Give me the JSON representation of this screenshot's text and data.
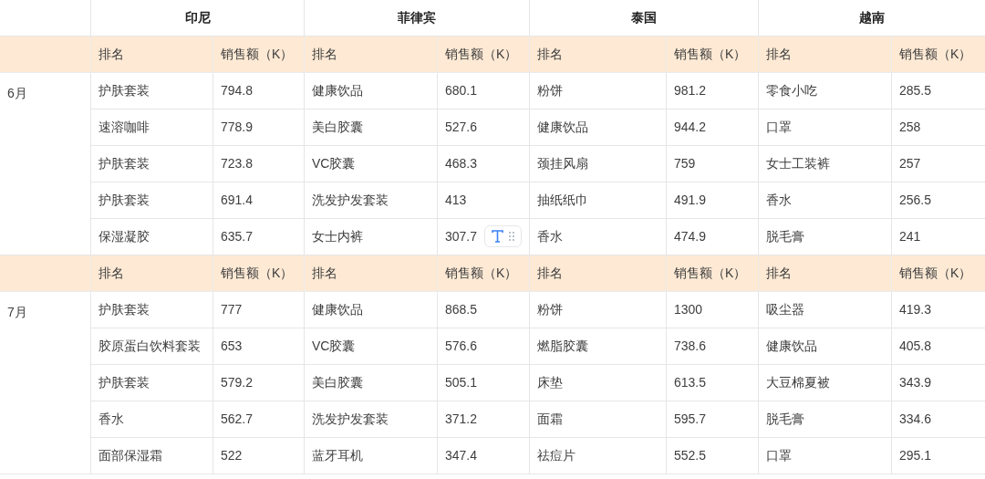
{
  "countries": [
    "印尼",
    "菲律宾",
    "泰国",
    "越南"
  ],
  "months": [
    {
      "month": "6月",
      "header": [
        "排名",
        "销售额（K）",
        "排名",
        "销售额（K）",
        "排名",
        "销售额（K）",
        "排名",
        "销售额（K）"
      ],
      "rows": [
        [
          "护肤套装",
          "794.8",
          "健康饮品",
          "680.1",
          "粉饼",
          "981.2",
          "零食小吃",
          "285.5"
        ],
        [
          "速溶咖啡",
          "778.9",
          "美白胶囊",
          "527.6",
          "健康饮品",
          "944.2",
          "口罩",
          "258"
        ],
        [
          "护肤套装",
          "723.8",
          "VC胶囊",
          "468.3",
          "颈挂风扇",
          "759",
          "女士工装裤",
          "257"
        ],
        [
          "护肤套装",
          "691.4",
          "洗发护发套装",
          "413",
          "抽纸纸巾",
          "491.9",
          "香水",
          "256.5"
        ],
        [
          "保湿凝胶",
          "635.7",
          "女士内裤",
          "307.7",
          "香水",
          "474.9",
          "脱毛膏",
          "241"
        ]
      ]
    },
    {
      "month": "7月",
      "header": [
        "排名",
        "销售额（K）",
        "排名",
        "销售额（K）",
        "排名",
        "销售额（K）",
        "排名",
        "销售额（K）"
      ],
      "rows": [
        [
          "护肤套装",
          "777",
          "健康饮品",
          "868.5",
          "粉饼",
          "1300",
          "吸尘器",
          "419.3"
        ],
        [
          "胶原蛋白饮料套装",
          "653",
          "VC胶囊",
          "576.6",
          "燃脂胶囊",
          "738.6",
          "健康饮品",
          "405.8"
        ],
        [
          "护肤套装",
          "579.2",
          "美白胶囊",
          "505.1",
          "床垫",
          "613.5",
          "大豆棉夏被",
          "343.9"
        ],
        [
          "香水",
          "562.7",
          "洗发护发套装",
          "371.2",
          "面霜",
          "595.7",
          "脱毛膏",
          "334.6"
        ],
        [
          "面部保湿霜",
          "522",
          "蓝牙耳机",
          "347.4",
          "祛痘片",
          "552.5",
          "口罩",
          "295.1"
        ]
      ]
    }
  ]
}
